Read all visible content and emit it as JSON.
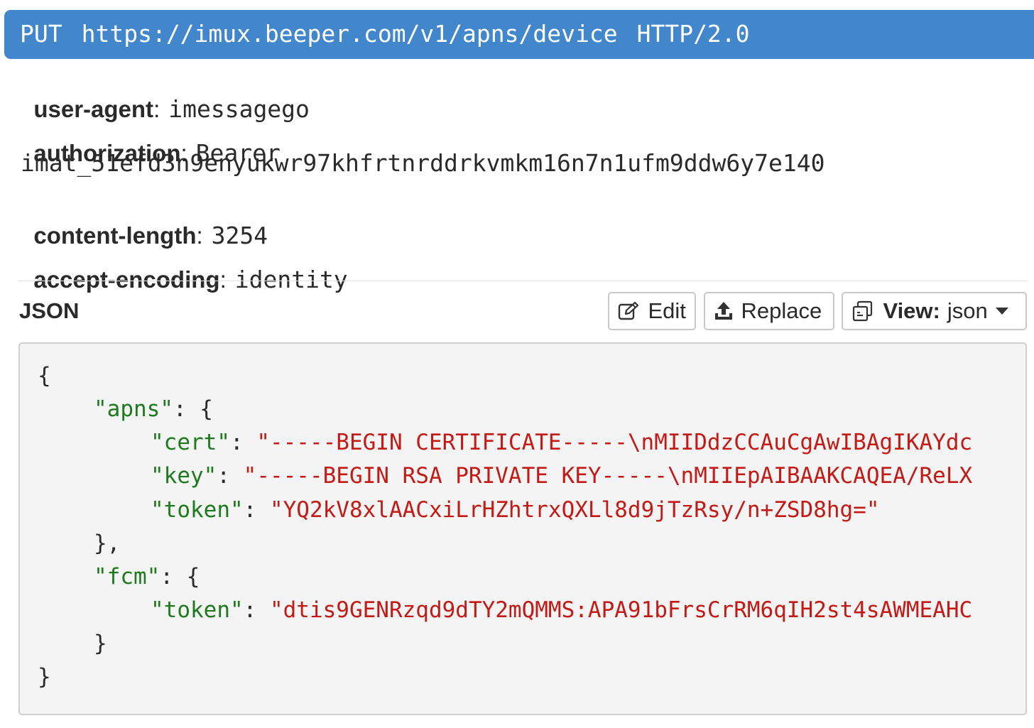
{
  "request": {
    "method": "PUT",
    "url": "https://imux.beeper.com/v1/apns/device",
    "protocol": "HTTP/2.0"
  },
  "headers": [
    {
      "name": "user-agent",
      "value": "imessagego"
    },
    {
      "name": "authorization",
      "value": "Bearer",
      "value_continued": "imat_51efd3n9enyukwr97khfrtnrddrkvmkm16n7n1ufm9ddw6y7e140"
    },
    {
      "name": "content-length",
      "value": "3254"
    },
    {
      "name": "accept-encoding",
      "value": "identity"
    }
  ],
  "body_section": {
    "title": "JSON",
    "edit_label": "Edit",
    "replace_label": "Replace",
    "view_label_bold": "View:",
    "view_value": "json",
    "icons": {
      "edit": "edit-icon",
      "replace": "upload-icon",
      "view": "copy-icon",
      "dropdown": "caret-down-icon"
    }
  },
  "json_body": {
    "open_brace": "{",
    "apns_key": "\"apns\"",
    "cert_key": "\"cert\"",
    "cert_value": "\"-----BEGIN CERTIFICATE-----\\nMIIDdzCCAuCgAwIBAgIKAYdc",
    "key_key": "\"key\"",
    "key_value": "\"-----BEGIN RSA PRIVATE KEY-----\\nMIIEpAIBAAKCAQEA/ReLX",
    "token_key": "\"token\"",
    "apns_token_value": "\"YQ2kV8xlAACxiLrHZhtrxQXLl8d9jTzRsy/n+ZSD8hg=\"",
    "fcm_key": "\"fcm\"",
    "fcm_token_value": "\"dtis9GENRzqd9dTY2mQMMS:APA91bFrsCrRM6qIH2st4sAWMEAHC",
    "close_brace": "}"
  },
  "colors": {
    "request_bar": "#4287cc",
    "json_key": "#1d7a1d",
    "json_string": "#c41a16",
    "code_background": "#f4f4f4"
  }
}
